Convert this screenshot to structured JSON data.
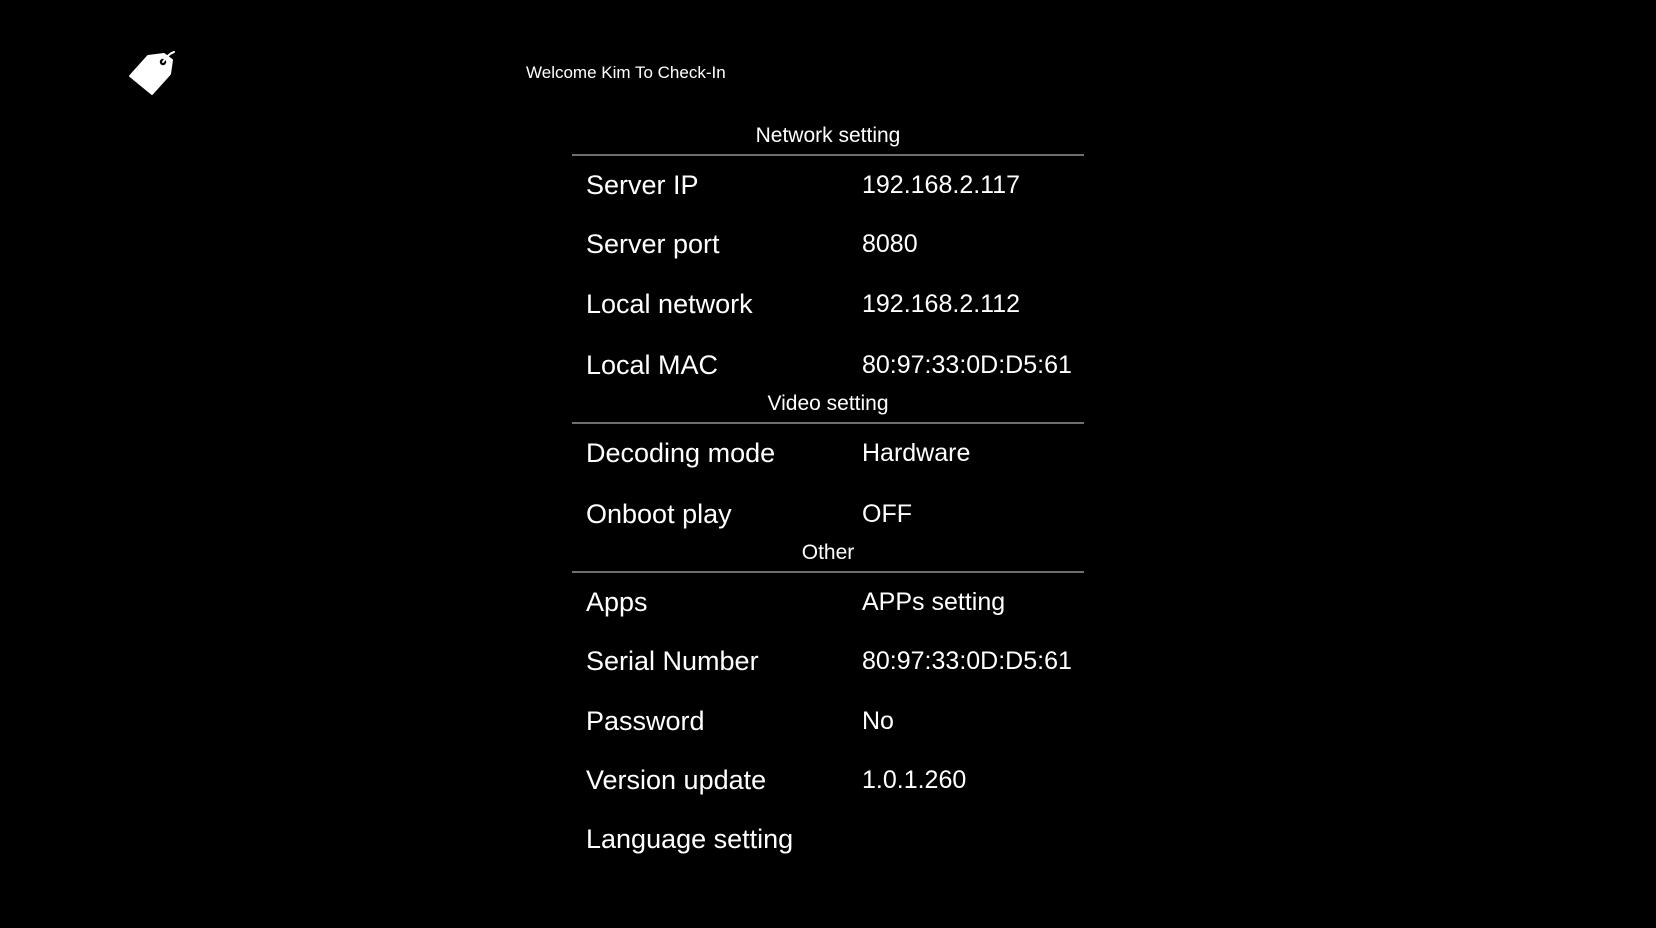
{
  "header": {
    "welcome_text": "Welcome Kim To Check-In",
    "logo_icon": "tag-icon"
  },
  "sections": [
    {
      "title": "Network setting",
      "items": [
        {
          "label": "Server IP",
          "value": "192.168.2.117"
        },
        {
          "label": "Server port",
          "value": "8080"
        },
        {
          "label": "Local network",
          "value": "192.168.2.112"
        },
        {
          "label": "Local MAC",
          "value": "80:97:33:0D:D5:61"
        }
      ]
    },
    {
      "title": "Video setting",
      "items": [
        {
          "label": "Decoding mode",
          "value": "Hardware"
        },
        {
          "label": "Onboot play",
          "value": "OFF"
        }
      ]
    },
    {
      "title": "Other",
      "items": [
        {
          "label": "Apps",
          "value": "APPs setting"
        },
        {
          "label": "Serial Number",
          "value": "80:97:33:0D:D5:61"
        },
        {
          "label": "Password",
          "value": "No"
        },
        {
          "label": "Version update",
          "value": "1.0.1.260"
        },
        {
          "label": "Language setting",
          "value": ""
        }
      ]
    }
  ],
  "colors": {
    "background": "#000000",
    "text": "#ffffff",
    "divider": "#6e6e6e"
  }
}
